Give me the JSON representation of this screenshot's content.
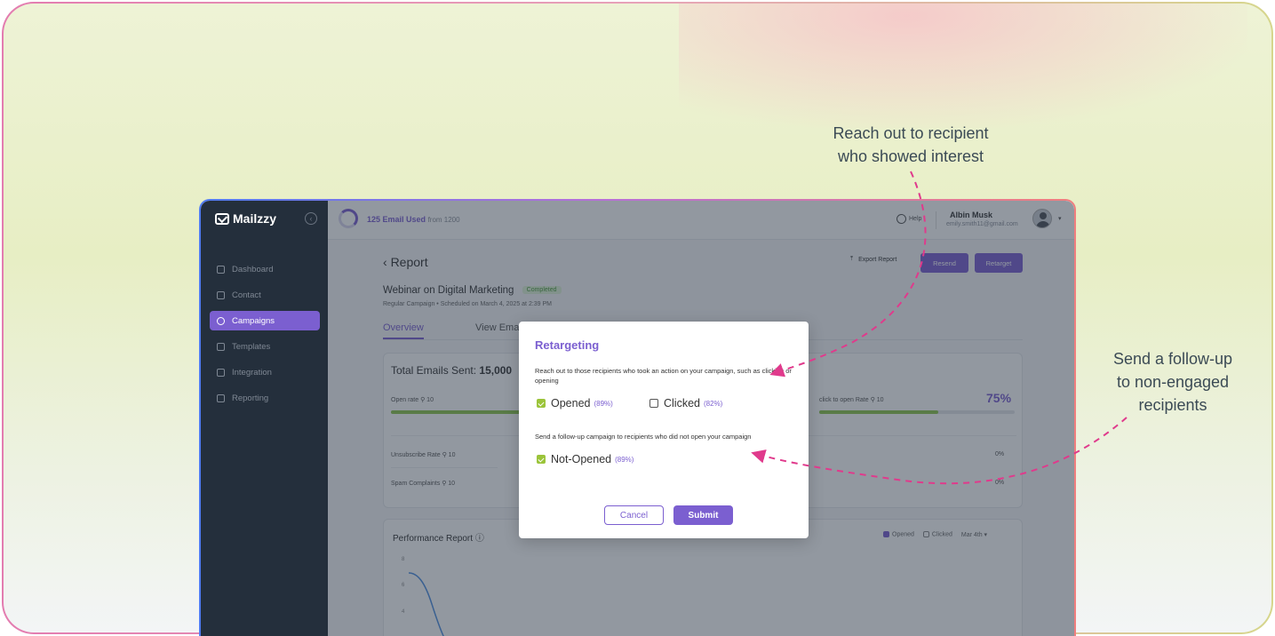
{
  "annotations": {
    "top": [
      "Reach out to recipient",
      "who showed interest"
    ],
    "right": [
      "Send a follow-up",
      "to non-engaged",
      "recipients"
    ]
  },
  "colors": {
    "accent": "#7b5fd0",
    "annotation_arrow": "#e03a8c",
    "success": "#9bc43a",
    "sidebar": "#242f3c"
  },
  "sidebar": {
    "brand": "Mailzzy",
    "items": [
      {
        "label": "Dashboard",
        "icon": "dashboard-icon",
        "active": false
      },
      {
        "label": "Contact",
        "icon": "contact-icon",
        "active": false
      },
      {
        "label": "Campaigns",
        "icon": "campaigns-icon",
        "active": true
      },
      {
        "label": "Templates",
        "icon": "templates-icon",
        "active": false
      },
      {
        "label": "Integration",
        "icon": "integration-icon",
        "active": false
      },
      {
        "label": "Reporting",
        "icon": "reporting-icon",
        "active": false
      }
    ]
  },
  "topbar": {
    "usage": "125 Email Used",
    "usage_sub": "from 1200",
    "help": "Help",
    "user_name": "Albin Musk",
    "user_email": "emily.smith11@gmail.com"
  },
  "report": {
    "title": "Report",
    "export_label": "Export Report",
    "resend_label": "Resend",
    "retarget_label": "Retarget",
    "campaign_name": "Webinar on Digital Marketing",
    "status": "Completed",
    "meta": "Regular Campaign  •  Scheduled on March 4, 2025 at 2:39 PM",
    "tabs": [
      "Overview",
      "View Ema"
    ],
    "total_sent_label": "Total Emails Sent:",
    "total_sent_value": "15,000",
    "open_rate_label": "Open rate",
    "open_rate_count": "10",
    "cto_label": "click to open Rate",
    "cto_count": "10",
    "cto_value": "75%",
    "unsub_label": "Unsubscribe Rate",
    "unsub_count": "10",
    "unsub_value": "0%",
    "spam_label": "Spam Complaints",
    "spam_count": "10",
    "spam_value": "0%"
  },
  "performance": {
    "title": "Performance Report",
    "legend_opened": "Opened",
    "legend_clicked": "Clicked",
    "date": "Mar 4th",
    "yticks": [
      "8",
      "6",
      "4"
    ]
  },
  "modal": {
    "title": "Retargeting",
    "desc1": "Reach out to those recipients who took an action on your campaign, such as clicking or opening",
    "opened_label": "Opened",
    "opened_pct": "(89%)",
    "opened_checked": true,
    "clicked_label": "Clicked",
    "clicked_pct": "(82%)",
    "clicked_checked": false,
    "desc2": "Send a follow-up campaign to recipients who did not open your campaign",
    "notopened_label": "Not-Opened",
    "notopened_pct": "(89%)",
    "notopened_checked": true,
    "cancel_label": "Cancel",
    "submit_label": "Submit"
  }
}
